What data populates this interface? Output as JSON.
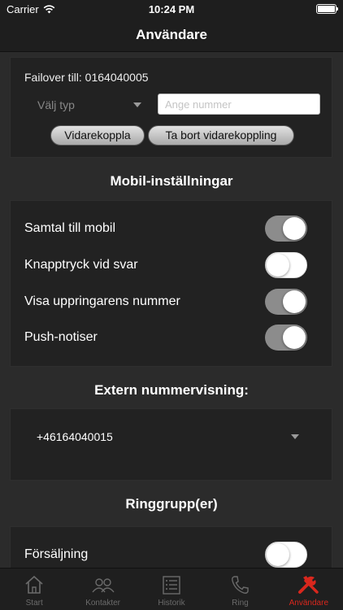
{
  "status_bar": {
    "carrier": "Carrier",
    "time": "10:24 PM"
  },
  "nav": {
    "title": "Användare"
  },
  "failover": {
    "title": "Failover till: 0164040005",
    "type_select": "Välj typ",
    "number_placeholder": "Ange nummer",
    "forward_button": "Vidarekoppla",
    "remove_button": "Ta bort vidarekoppling"
  },
  "mobile_settings": {
    "title": "Mobil-inställningar",
    "rows": [
      {
        "label": "Samtal till mobil",
        "on": true
      },
      {
        "label": "Knapptryck vid svar",
        "on": false
      },
      {
        "label": "Visa uppringarens nummer",
        "on": true
      },
      {
        "label": "Push-notiser",
        "on": true
      }
    ]
  },
  "extern": {
    "title": "Extern nummervisning:",
    "value": "+46164040015"
  },
  "ring_groups": {
    "title": "Ringgrupp(er)",
    "rows": [
      {
        "label": "Försäljning",
        "on": false
      }
    ]
  },
  "tabs": [
    {
      "label": "Start",
      "icon": "home-icon",
      "active": false
    },
    {
      "label": "Kontakter",
      "icon": "contacts-icon",
      "active": false
    },
    {
      "label": "Historik",
      "icon": "history-icon",
      "active": false
    },
    {
      "label": "Ring",
      "icon": "phone-icon",
      "active": false
    },
    {
      "label": "Användare",
      "icon": "tools-icon",
      "active": true
    }
  ],
  "colors": {
    "accent": "#d9271d",
    "background": "#2b2b2b",
    "card": "#222222",
    "toggle_on": "#8c8c8c"
  }
}
